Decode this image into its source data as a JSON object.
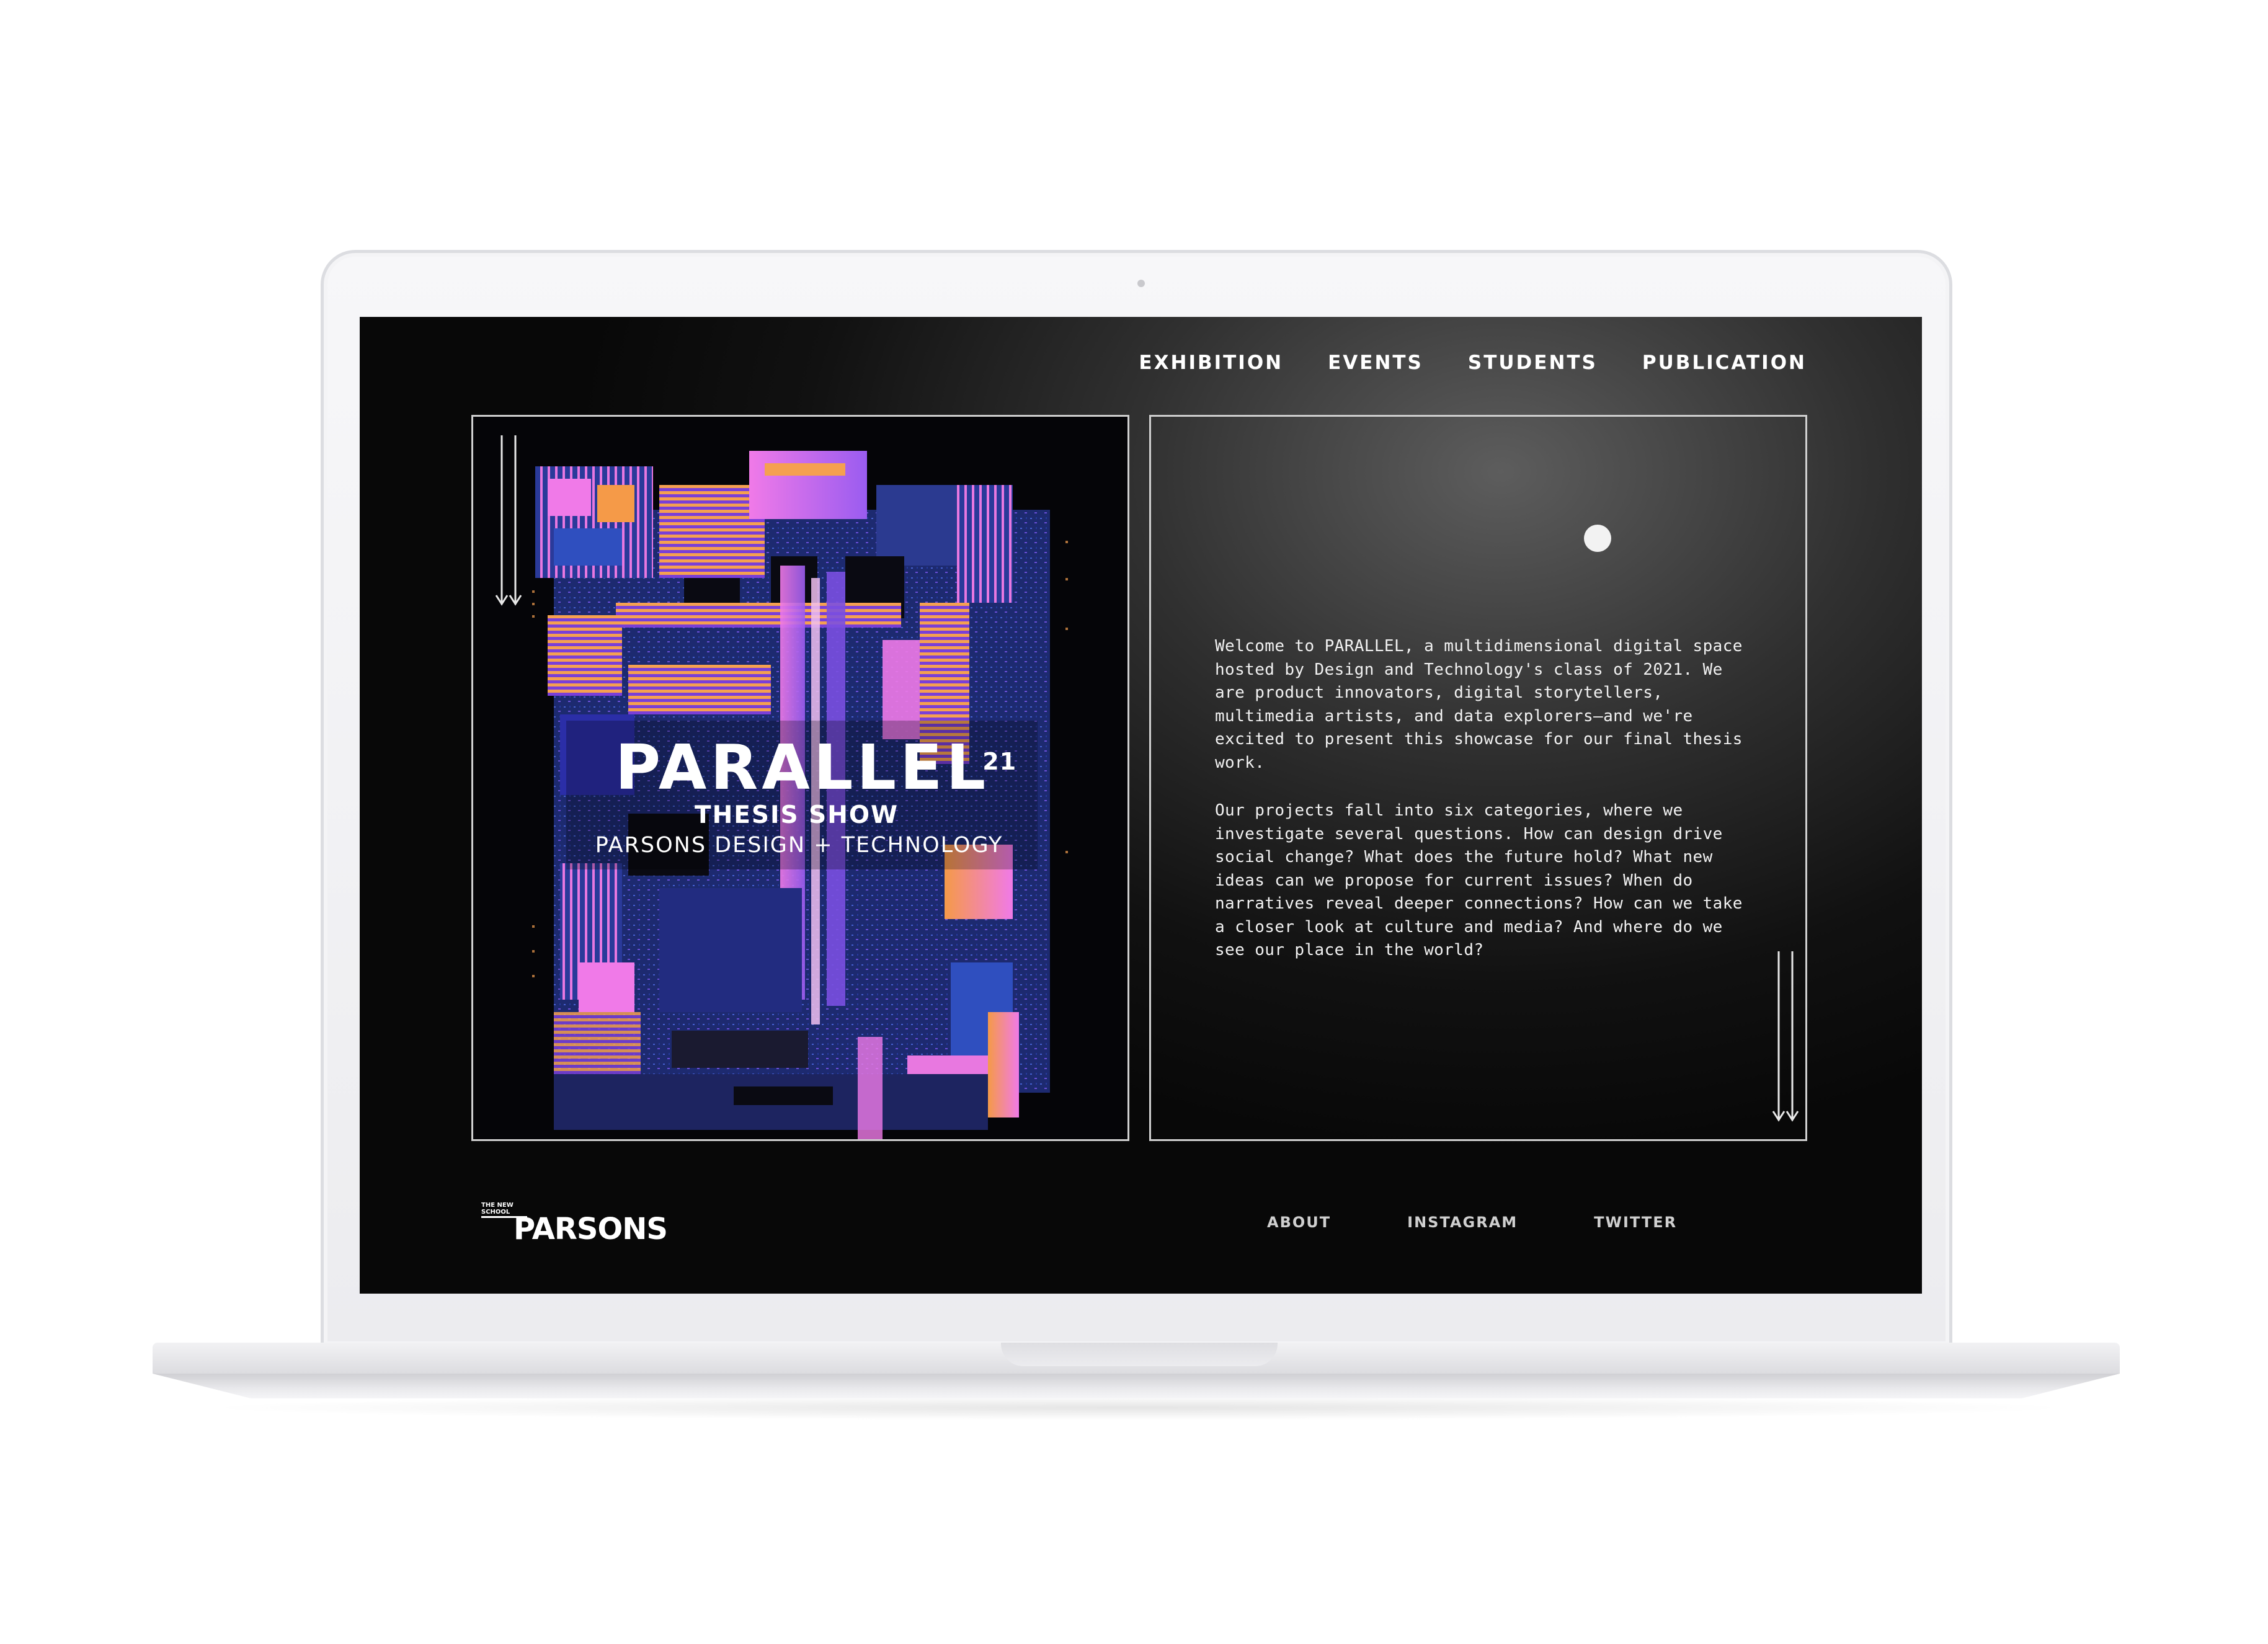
{
  "nav": {
    "items": [
      {
        "label": "EXHIBITION"
      },
      {
        "label": "EVENTS"
      },
      {
        "label": "STUDENTS"
      },
      {
        "label": "PUBLICATION"
      }
    ]
  },
  "poster": {
    "title": "PARALLEL",
    "superscript": "21",
    "subtitle": "THESIS SHOW",
    "department": "PARSONS DESIGN + TECHNOLOGY",
    "colors": {
      "pink": "#e06be0",
      "violet": "#8a5cf0",
      "navy": "#1b2a6e",
      "orange": "#f08a3c",
      "blue": "#2f4fbf"
    }
  },
  "intro": {
    "paragraph_1": "Welcome to PARALLEL, a multidimensional digital space hosted by Design and Technology's class of 2021. We are product innovators, digital storytellers, multimedia artists, and data explorers—and we're excited to present this showcase for our final thesis work.",
    "paragraph_2": "Our projects fall into six categories, where we investigate several questions. How can design drive social change? What does the future hold? What new ideas can we propose for current issues? When do narratives reveal deeper connections? How can we take a closer look at culture and media? And where do we see our place in the world?"
  },
  "footer": {
    "logo_small": "THE NEW SCHOOL",
    "logo_big": "PARSONS",
    "links": [
      {
        "label": "ABOUT"
      },
      {
        "label": "INSTAGRAM"
      },
      {
        "label": "TWITTER"
      }
    ]
  }
}
